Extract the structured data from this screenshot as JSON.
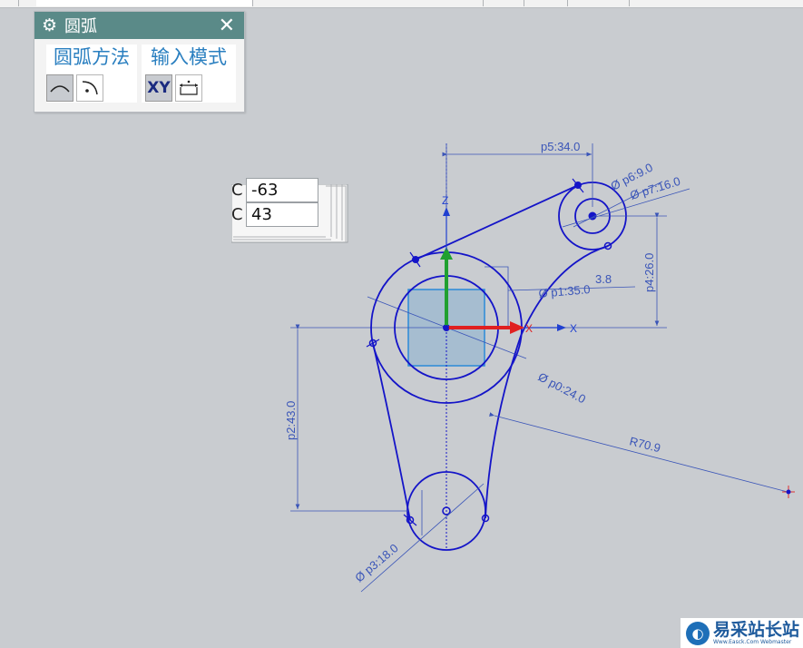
{
  "dialog": {
    "title": "圆弧",
    "close_glyph": "✕",
    "gear_icon": "gear-icon",
    "method_group_label": "圆弧方法",
    "input_group_label": "输入模式",
    "xy_button_label": "XY"
  },
  "coord_input": {
    "xc_label": "C",
    "xc_value": "-63",
    "yc_label": "C",
    "yc_value": "43"
  },
  "axes": {
    "z_label": "Z",
    "x_label": "X",
    "x_label_2": "X"
  },
  "dimensions": {
    "p5": "p5:34.0",
    "p6": "Ø p6:9.0",
    "p7": "Ø p7:16.0",
    "p4": "p4:26.0",
    "p1": "Ø p1:35.0",
    "p1_extra": "3.8",
    "p0": "Ø p0:24.0",
    "r": "R70.9",
    "p2": "p2:43.0",
    "p3": "Ø p3:18.0"
  },
  "watermark": {
    "text": "易采站长站",
    "subtext": "Www.Easck.Com Webmaster"
  },
  "colors": {
    "geometry": "#1414c8",
    "dimension": "#3a55b8",
    "background": "#c9ccd0",
    "title_bar": "#5a8a88",
    "x_axis": "#e02020",
    "y_axis": "#20a030",
    "z_axis": "#2040d0",
    "plane": "#5aa0d8"
  }
}
